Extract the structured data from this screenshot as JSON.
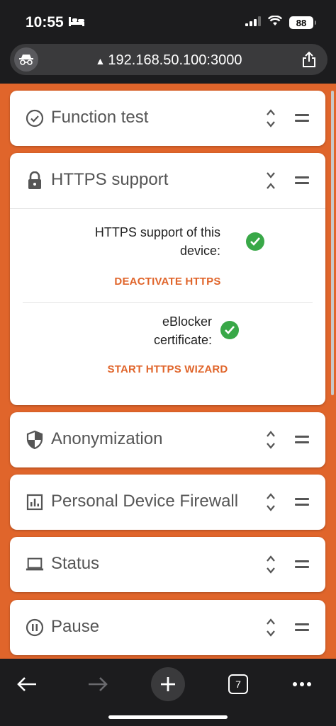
{
  "status": {
    "time": "10:55",
    "battery": "88"
  },
  "browser": {
    "url": "192.168.50.100:3000",
    "tab_count": "7"
  },
  "cards": [
    {
      "title": "Function test",
      "icon": "check-circle-icon"
    },
    {
      "title": "HTTPS support",
      "icon": "lock-icon",
      "expanded": true
    },
    {
      "title": "Anonymization",
      "icon": "shield-icon"
    },
    {
      "title": "Personal Device Firewall",
      "icon": "chart-icon"
    },
    {
      "title": "Status",
      "icon": "laptop-icon"
    },
    {
      "title": "Pause",
      "icon": "pause-icon"
    }
  ],
  "https": {
    "support_line1": "HTTPS support of this",
    "support_line2": "device:",
    "deactivate": "DEACTIVATE HTTPS",
    "cert_line1": "eBlocker",
    "cert_line2": "certificate:",
    "wizard": "START HTTPS WIZARD"
  },
  "colors": {
    "accent": "#e0652b",
    "success": "#39a848"
  }
}
